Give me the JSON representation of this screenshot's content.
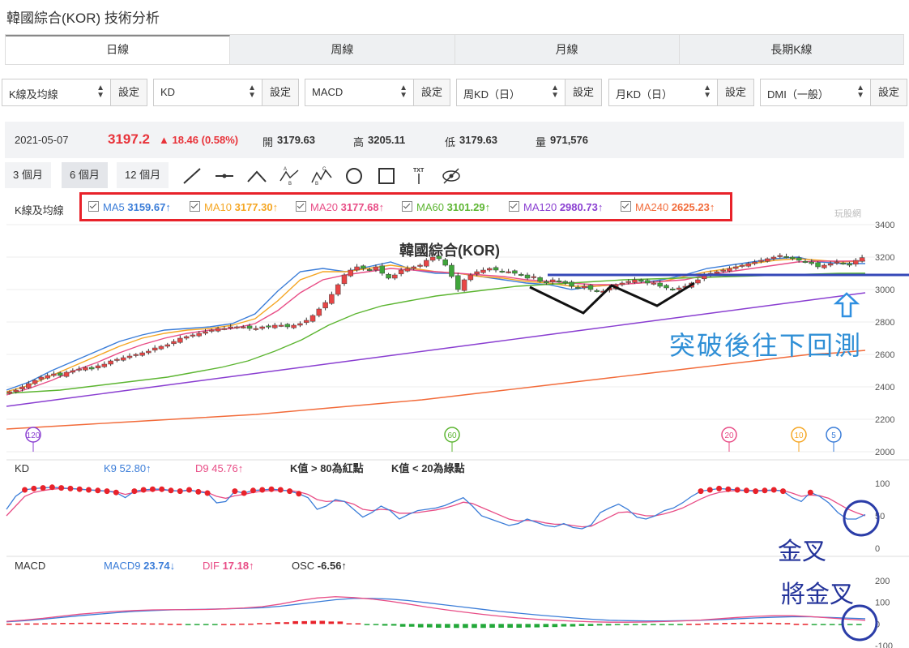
{
  "page_title": "韓國綜合(KOR) 技術分析",
  "tabs": [
    "日線",
    "周線",
    "月線",
    "長期K線"
  ],
  "selectors": [
    {
      "label": "K線及均線",
      "button": "設定"
    },
    {
      "label": "KD",
      "button": "設定"
    },
    {
      "label": "MACD",
      "button": "設定"
    },
    {
      "label": "周KD（日）",
      "button": "設定"
    },
    {
      "label": "月KD（日）",
      "button": "設定"
    },
    {
      "label": "DMI（一般）",
      "button": "設定"
    }
  ],
  "quote": {
    "date": "2021-05-07",
    "price": "3197.2",
    "change": "▲ 18.46 (0.58%)",
    "open_label": "開",
    "open": "3179.63",
    "high_label": "高",
    "high": "3205.11",
    "low_label": "低",
    "low": "3179.63",
    "vol_label": "量",
    "volume": "971,576"
  },
  "periods": [
    "3 個月",
    "6 個月",
    "12 個月"
  ],
  "tools": [
    "line-tool-icon",
    "segment-tool-icon",
    "angle-tool-icon",
    "abc-pattern-icon",
    "abcd-pattern-icon",
    "circle-tool-icon",
    "rect-tool-icon",
    "text-tool-icon",
    "hide-eye-icon"
  ],
  "kline_label": "K線及均線",
  "ma_legend": [
    {
      "name": "MA5",
      "value": "3159.67↑",
      "color": "#3b7dd8"
    },
    {
      "name": "MA10",
      "value": "3177.30↑",
      "color": "#f5a623"
    },
    {
      "name": "MA20",
      "value": "3177.68↑",
      "color": "#e84d86"
    },
    {
      "name": "MA60",
      "value": "3101.29↑",
      "color": "#5cb531"
    },
    {
      "name": "MA120",
      "value": "2980.73↑",
      "color": "#8a3fd1"
    },
    {
      "name": "MA240",
      "value": "2625.23↑",
      "color": "#f26b3a"
    }
  ],
  "watermark": "玩股網",
  "chart_data": [
    {
      "type": "candlestick",
      "title": "韓國綜合(KOR)",
      "ylim": [
        2000,
        3400
      ],
      "yticks": [
        "3400",
        "3200",
        "3000",
        "2800",
        "2600",
        "2400",
        "2200",
        "2000"
      ],
      "close_series": [
        2370,
        2380,
        2400,
        2420,
        2440,
        2460,
        2470,
        2480,
        2470,
        2490,
        2500,
        2510,
        2520,
        2510,
        2530,
        2540,
        2560,
        2570,
        2580,
        2590,
        2600,
        2610,
        2620,
        2640,
        2650,
        2660,
        2680,
        2700,
        2710,
        2720,
        2730,
        2740,
        2750,
        2760,
        2760,
        2770,
        2770,
        2770,
        2760,
        2760,
        2770,
        2770,
        2780,
        2780,
        2770,
        2780,
        2790,
        2810,
        2840,
        2880,
        2920,
        2970,
        3030,
        3090,
        3120,
        3140,
        3130,
        3120,
        3140,
        3100,
        3070,
        3090,
        3120,
        3130,
        3140,
        3150,
        3180,
        3200,
        3190,
        3150,
        3080,
        3000,
        3060,
        3090,
        3110,
        3120,
        3130,
        3120,
        3110,
        3110,
        3100,
        3090,
        3070,
        3080,
        3050,
        3040,
        3060,
        3050,
        3040,
        3020,
        3010,
        3020,
        3000,
        2990,
        2990,
        3010,
        3030,
        3040,
        3050,
        3060,
        3050,
        3040,
        3040,
        3020,
        3010,
        3000,
        3010,
        3020,
        3040,
        3060,
        3090,
        3100,
        3110,
        3120,
        3130,
        3140,
        3150,
        3160,
        3170,
        3180,
        3190,
        3200,
        3210,
        3200,
        3190,
        3180,
        3170,
        3160,
        3140,
        3150,
        3160,
        3170,
        3160,
        3150,
        3180,
        3197
      ],
      "ma_lines": {
        "MA5": [
          2380,
          2430,
          2500,
          2560,
          2620,
          2680,
          2720,
          2750,
          2760,
          2770,
          2790,
          2850,
          2990,
          3110,
          3130,
          3110,
          3140,
          3170,
          3120,
          3100,
          3100,
          3080,
          3060,
          3040,
          3030,
          3000,
          3020,
          3030,
          3040,
          3060,
          3090,
          3130,
          3150,
          3170,
          3190,
          3200,
          3170,
          3160,
          3160
        ],
        "MA10": [
          2370,
          2410,
          2470,
          2530,
          2590,
          2650,
          2700,
          2730,
          2750,
          2760,
          2780,
          2820,
          2930,
          3060,
          3110,
          3110,
          3130,
          3150,
          3130,
          3110,
          3100,
          3080,
          3070,
          3050,
          3040,
          3020,
          3020,
          3030,
          3040,
          3050,
          3080,
          3110,
          3130,
          3160,
          3180,
          3190,
          3180,
          3170,
          3177
        ],
        "MA20": [
          2350,
          2390,
          2440,
          2500,
          2550,
          2610,
          2660,
          2700,
          2730,
          2750,
          2760,
          2790,
          2870,
          2980,
          3060,
          3090,
          3110,
          3130,
          3120,
          3110,
          3100,
          3090,
          3080,
          3060,
          3050,
          3040,
          3030,
          3030,
          3040,
          3050,
          3060,
          3090,
          3110,
          3130,
          3150,
          3170,
          3175,
          3175,
          3177
        ],
        "MA60": [
          2360,
          2370,
          2380,
          2400,
          2420,
          2440,
          2460,
          2490,
          2520,
          2560,
          2620,
          2690,
          2780,
          2850,
          2900,
          2930,
          2960,
          2980,
          3000,
          3020,
          3030,
          3040,
          3050,
          3060,
          3065,
          3070,
          3075,
          3080,
          3085,
          3090,
          3095,
          3100,
          3101
        ],
        "MA120": [
          2280,
          2300,
          2320,
          2340,
          2360,
          2380,
          2400,
          2420,
          2440,
          2460,
          2480,
          2500,
          2520,
          2540,
          2560,
          2580,
          2600,
          2620,
          2640,
          2660,
          2680,
          2700,
          2720,
          2740,
          2760,
          2780,
          2800,
          2820,
          2840,
          2860,
          2880,
          2900,
          2920,
          2940,
          2960,
          2980
        ],
        "MA240": [
          2140,
          2150,
          2160,
          2170,
          2180,
          2190,
          2200,
          2210,
          2220,
          2230,
          2245,
          2260,
          2275,
          2290,
          2305,
          2320,
          2340,
          2360,
          2380,
          2400,
          2420,
          2440,
          2460,
          2480,
          2500,
          2520,
          2540,
          2560,
          2580,
          2600,
          2610,
          2625
        ]
      },
      "markers": [
        "120",
        "60",
        "20",
        "10",
        "5"
      ],
      "annotations": [
        "突破後往下回測"
      ],
      "breakout_level": 3090
    },
    {
      "type": "line",
      "label": "KD",
      "legend": [
        {
          "name": "K9",
          "value": "52.80↑",
          "color": "#3b7dd8"
        },
        {
          "name": "D9",
          "value": "45.76↑",
          "color": "#e84d86"
        }
      ],
      "notes": [
        "K值 > 80為紅點",
        "K值 < 20為綠點"
      ],
      "ylim": [
        0,
        100
      ],
      "yticks": [
        "100",
        "50",
        "0"
      ],
      "K": [
        60,
        80,
        90,
        92,
        93,
        94,
        93,
        92,
        91,
        90,
        89,
        88,
        86,
        78,
        88,
        90,
        91,
        91,
        89,
        88,
        90,
        87,
        85,
        70,
        72,
        88,
        85,
        89,
        90,
        91,
        90,
        88,
        84,
        78,
        60,
        65,
        75,
        72,
        60,
        48,
        55,
        65,
        58,
        45,
        52,
        58,
        60,
        62,
        66,
        72,
        78,
        65,
        50,
        45,
        40,
        35,
        38,
        45,
        40,
        35,
        33,
        38,
        32,
        30,
        36,
        55,
        62,
        68,
        60,
        48,
        45,
        50,
        58,
        62,
        70,
        80,
        88,
        90,
        92,
        91,
        90,
        89,
        88,
        89,
        90,
        88,
        78,
        72,
        86,
        80,
        70,
        55,
        45,
        45,
        52
      ],
      "D": [
        50,
        65,
        80,
        86,
        89,
        91,
        92,
        92,
        91,
        90,
        89,
        88,
        87,
        83,
        86,
        88,
        89,
        90,
        89,
        88,
        89,
        88,
        86,
        80,
        77,
        81,
        83,
        86,
        88,
        89,
        89,
        89,
        87,
        83,
        75,
        72,
        73,
        72,
        68,
        60,
        58,
        60,
        59,
        54,
        54,
        55,
        57,
        59,
        62,
        66,
        71,
        69,
        63,
        57,
        51,
        45,
        42,
        43,
        42,
        39,
        37,
        37,
        35,
        33,
        34,
        41,
        48,
        55,
        56,
        53,
        50,
        50,
        53,
        57,
        62,
        69,
        76,
        82,
        86,
        88,
        89,
        89,
        89,
        89,
        89,
        89,
        85,
        80,
        82,
        81,
        77,
        69,
        61,
        55,
        50
      ]
    },
    {
      "type": "bar",
      "label": "MACD",
      "legend": [
        {
          "name": "MACD9",
          "value": "23.74↓",
          "color": "#3b7dd8"
        },
        {
          "name": "DIF",
          "value": "17.18↑",
          "color": "#e84d86"
        },
        {
          "name": "OSC",
          "value": "-6.56↑",
          "color": "#333333"
        }
      ],
      "ylim": [
        -100,
        200
      ],
      "yticks": [
        "200",
        "100",
        "0",
        "-100"
      ],
      "MACD": [
        10,
        15,
        22,
        30,
        38,
        45,
        52,
        58,
        62,
        65,
        67,
        68,
        70,
        72,
        75,
        82,
        92,
        102,
        112,
        118,
        118,
        115,
        108,
        98,
        88,
        78,
        68,
        58,
        50,
        42,
        35,
        28,
        22,
        17,
        15,
        14,
        14,
        15,
        17,
        20,
        24,
        28,
        31,
        33,
        33,
        30,
        27,
        24
      ],
      "DIF": [
        12,
        18,
        26,
        36,
        45,
        52,
        58,
        62,
        65,
        66,
        66,
        67,
        70,
        74,
        80,
        92,
        108,
        120,
        126,
        122,
        115,
        105,
        92,
        78,
        66,
        55,
        45,
        36,
        28,
        22,
        17,
        13,
        10,
        8,
        8,
        9,
        11,
        14,
        18,
        24,
        30,
        35,
        38,
        38,
        34,
        28,
        22,
        17
      ]
    }
  ],
  "overlay_notes": [
    "金叉",
    "將金叉"
  ]
}
